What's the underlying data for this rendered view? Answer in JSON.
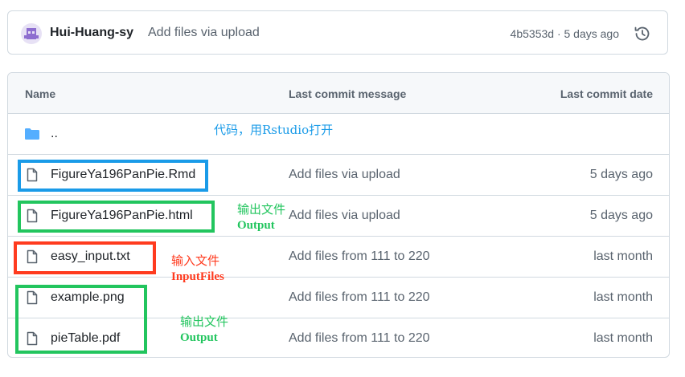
{
  "commit": {
    "author": "Hui-Huang-sy",
    "message": "Add files via upload",
    "sha_date": "4b5353d · 5 days ago",
    "history_icon": "history-icon"
  },
  "table": {
    "headers": {
      "name": "Name",
      "message": "Last commit message",
      "date": "Last commit date"
    },
    "parent_dir": "..",
    "files": [
      {
        "name": "FigureYa196PanPie.Rmd",
        "message": "Add files via upload",
        "date": "5 days ago"
      },
      {
        "name": "FigureYa196PanPie.html",
        "message": "Add files via upload",
        "date": "5 days ago"
      },
      {
        "name": "easy_input.txt",
        "message": "Add files from 111 to 220",
        "date": "last month"
      },
      {
        "name": "example.png",
        "message": "Add files from 111 to 220",
        "date": "last month"
      },
      {
        "name": "pieTable.pdf",
        "message": "Add files from 111 to 220",
        "date": "last month"
      }
    ]
  },
  "annotations": {
    "code": {
      "text": "代码，用Rstudio打开",
      "color": "#1a9be8"
    },
    "output_html": {
      "text": "输出文件",
      "sub": "Output",
      "color": "#22c55e"
    },
    "input": {
      "text": "输入文件",
      "sub": "InputFiles",
      "color": "#ff3b1f"
    },
    "output_files": {
      "text": "输出文件",
      "sub": "Output",
      "color": "#22c55e"
    }
  },
  "colors": {
    "folder": "#54aeff",
    "border": "#d1d9e0",
    "muted": "#59636e"
  }
}
